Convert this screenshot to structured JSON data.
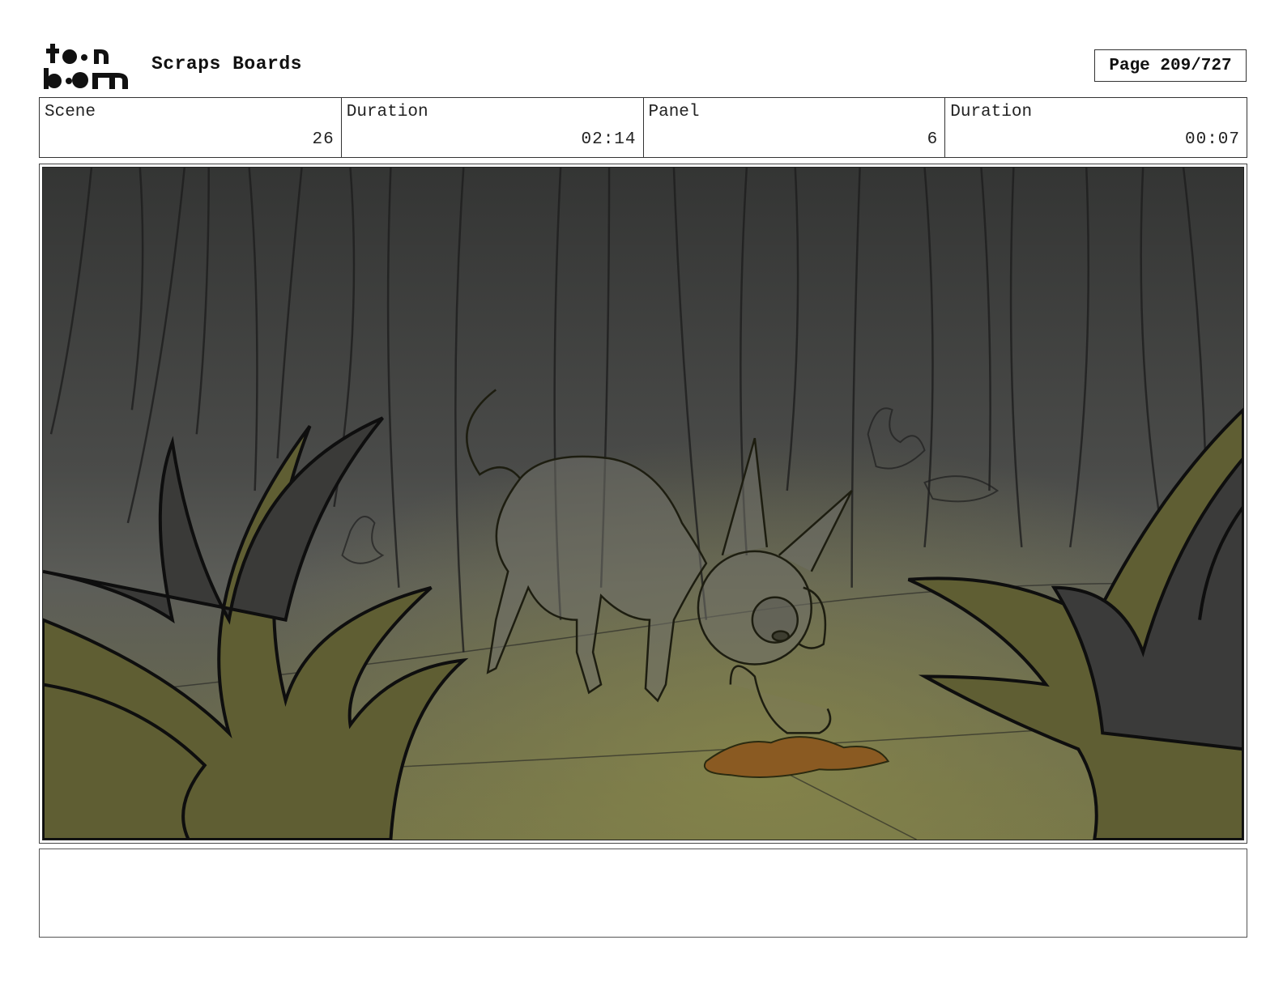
{
  "header": {
    "logo_text": "toon boom",
    "title": "Scraps Boards",
    "page": "Page 209/727"
  },
  "info": {
    "scene_label": "Scene",
    "scene_value": "26",
    "scene_duration_label": "Duration",
    "scene_duration_value": "02:14",
    "panel_label": "Panel",
    "panel_value": "6",
    "panel_duration_label": "Duration",
    "panel_duration_value": "00:07"
  },
  "panel_image": {
    "description_icon": "storyboard-sketch-dog-sniffing-in-forest",
    "colors": {
      "forest_dark": "#3a3b3a",
      "forest_mid": "#5a5a58",
      "ground_olive": "#7a7a4a",
      "bush_olive": "#5f5e33",
      "bush_dark": "#3c3c3c",
      "puddle": "#8a5a22"
    }
  },
  "notes": {
    "text": ""
  }
}
